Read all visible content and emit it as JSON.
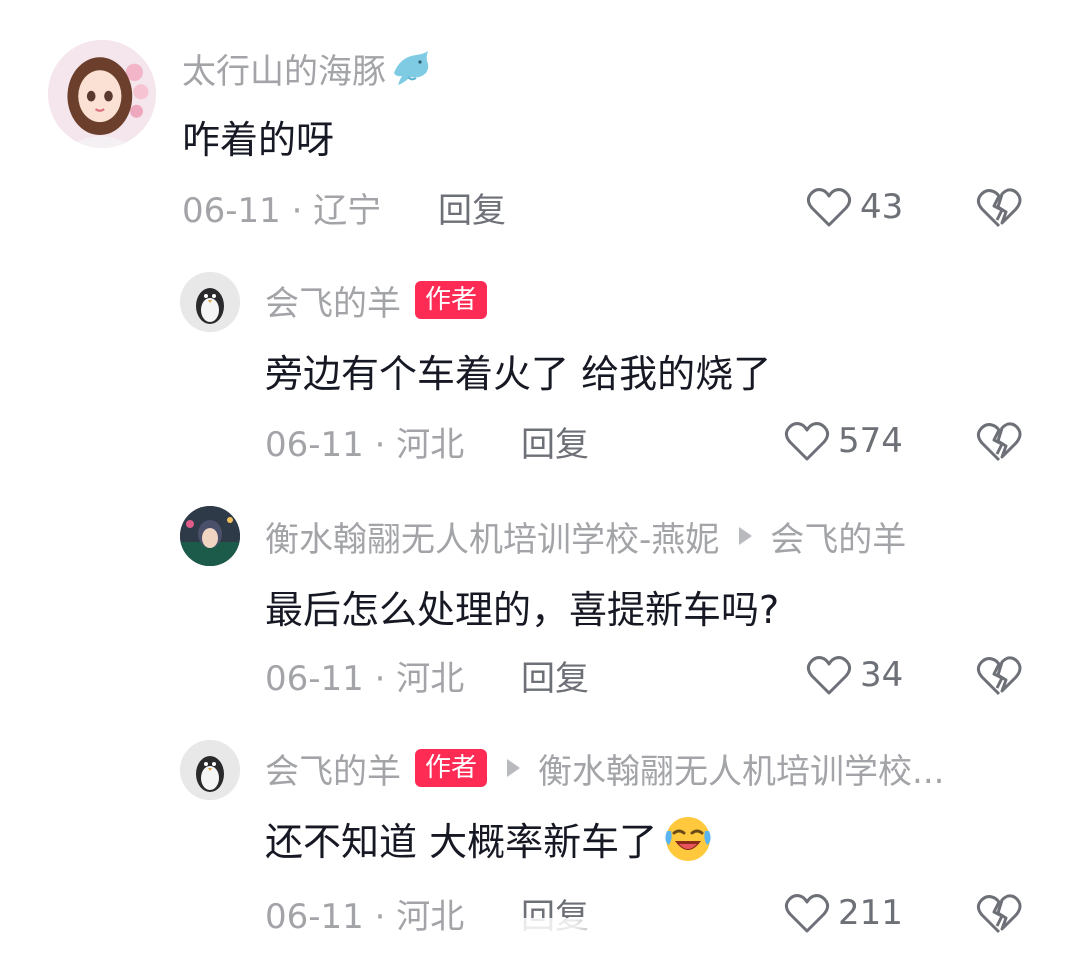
{
  "comments": [
    {
      "username": "太行山的海豚",
      "username_emoji": "dolphin-icon",
      "text": "咋着的呀",
      "date_location": "06-11 · 辽宁",
      "reply_label": "回复",
      "likes": "43"
    },
    {
      "username": "会飞的羊",
      "badge": "作者",
      "text": "旁边有个车着火了 给我的烧了",
      "date_location": "06-11 · 河北",
      "reply_label": "回复",
      "likes": "574"
    },
    {
      "username": "衡水翰翮无人机培训学校-燕妮",
      "reply_to": "会飞的羊",
      "text": "最后怎么处理的，喜提新车吗?",
      "date_location": "06-11 · 河北",
      "reply_label": "回复",
      "likes": "34"
    },
    {
      "username": "会飞的羊",
      "badge": "作者",
      "reply_to": "衡水翰翮无人机培训学校...",
      "text": "还不知道 大概率新车了",
      "text_emoji": "laughing-crying-emoji",
      "date_location": "06-11 · 河北",
      "reply_label": "回复",
      "likes": "211"
    }
  ],
  "colors": {
    "author_badge": "#fe2c55",
    "muted_text": "#a3a4a8",
    "primary_text": "#161823"
  }
}
